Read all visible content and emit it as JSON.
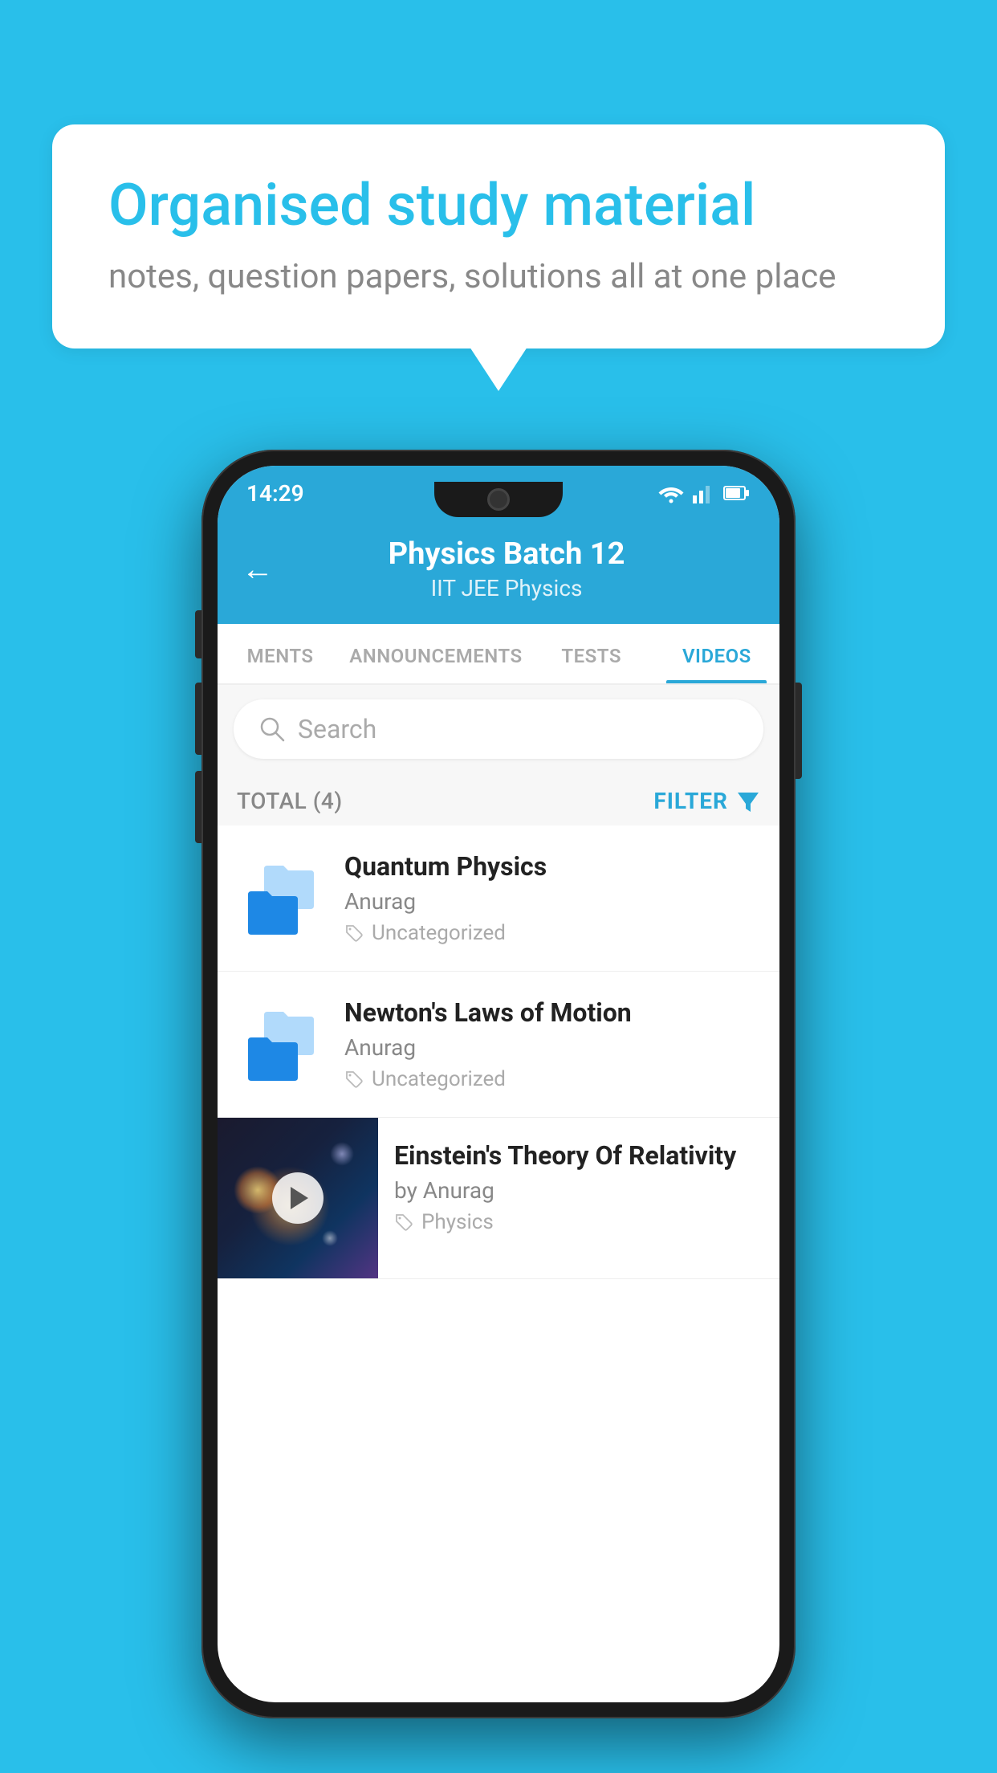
{
  "background_color": "#29BFEA",
  "speech_bubble": {
    "title": "Organised study material",
    "subtitle": "notes, question papers, solutions all at one place"
  },
  "phone": {
    "status_bar": {
      "time": "14:29",
      "wifi": true,
      "signal": true,
      "battery": true
    },
    "header": {
      "back_label": "←",
      "title": "Physics Batch 12",
      "subtitle": "IIT JEE    Physics"
    },
    "tabs": [
      {
        "label": "MENTS",
        "active": false
      },
      {
        "label": "ANNOUNCEMENTS",
        "active": false
      },
      {
        "label": "TESTS",
        "active": false
      },
      {
        "label": "VIDEOS",
        "active": true
      }
    ],
    "search": {
      "placeholder": "Search"
    },
    "filter": {
      "total_label": "TOTAL (4)",
      "filter_label": "FILTER"
    },
    "videos": [
      {
        "id": 1,
        "title": "Quantum Physics",
        "author": "Anurag",
        "tag": "Uncategorized",
        "type": "folder"
      },
      {
        "id": 2,
        "title": "Newton's Laws of Motion",
        "author": "Anurag",
        "tag": "Uncategorized",
        "type": "folder"
      },
      {
        "id": 3,
        "title": "Einstein's Theory Of Relativity",
        "author": "by Anurag",
        "tag": "Physics",
        "type": "video"
      }
    ]
  }
}
